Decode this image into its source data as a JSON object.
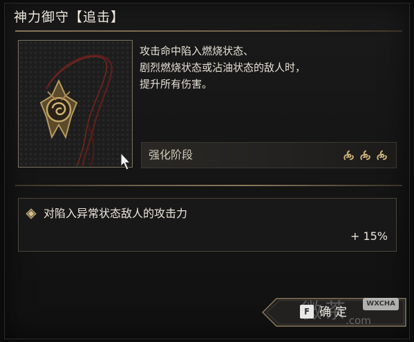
{
  "header": {
    "title": "神力御守【追击】"
  },
  "item": {
    "icon": "pendant-amulet-icon",
    "description": "攻击命中陷入燃烧状态、\n剧烈燃烧状态或沾油状态的敌人时，\n提升所有伤害。"
  },
  "enhance": {
    "label": "强化阶段",
    "stages_total": 3,
    "stage_icon": "flame-swirl-icon"
  },
  "effect": {
    "bullet_icon": "diamond-bullet-icon",
    "name": "对陷入异常状态敌人的攻击力",
    "value": "+ 15%"
  },
  "actions": {
    "confirm_key": "F",
    "confirm_label": "确定"
  },
  "watermark": {
    "badge": "WXCHA",
    "text": "微茶",
    "url": ".com"
  },
  "colors": {
    "background": "#0b0b0b",
    "gold_rule": "#8a7a5c",
    "text_primary": "#e6e1d6"
  }
}
